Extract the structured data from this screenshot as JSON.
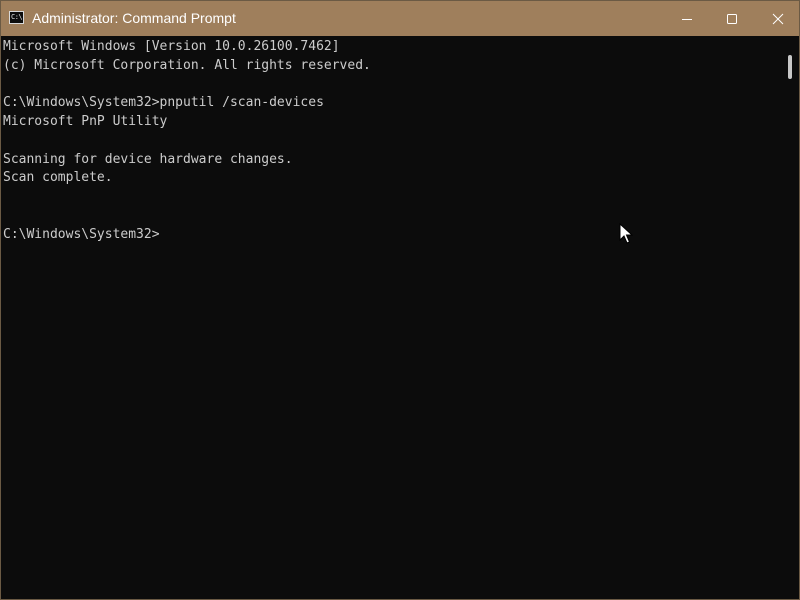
{
  "window": {
    "title": "Administrator: Command Prompt",
    "app_icon_glyph": "C:\\",
    "titlebar_color": "#9f7f5c",
    "background_color": "#0c0c0c",
    "text_color": "#cccccc"
  },
  "caption_buttons": {
    "minimize_icon": "minimize-icon",
    "maximize_icon": "maximize-icon",
    "close_icon": "close-icon"
  },
  "console": {
    "lines": [
      "Microsoft Windows [Version 10.0.26100.7462]",
      "(c) Microsoft Corporation. All rights reserved.",
      "",
      "C:\\Windows\\System32>pnputil /scan-devices",
      "Microsoft PnP Utility",
      "",
      "Scanning for device hardware changes.",
      "Scan complete.",
      "",
      "",
      "C:\\Windows\\System32>"
    ]
  }
}
